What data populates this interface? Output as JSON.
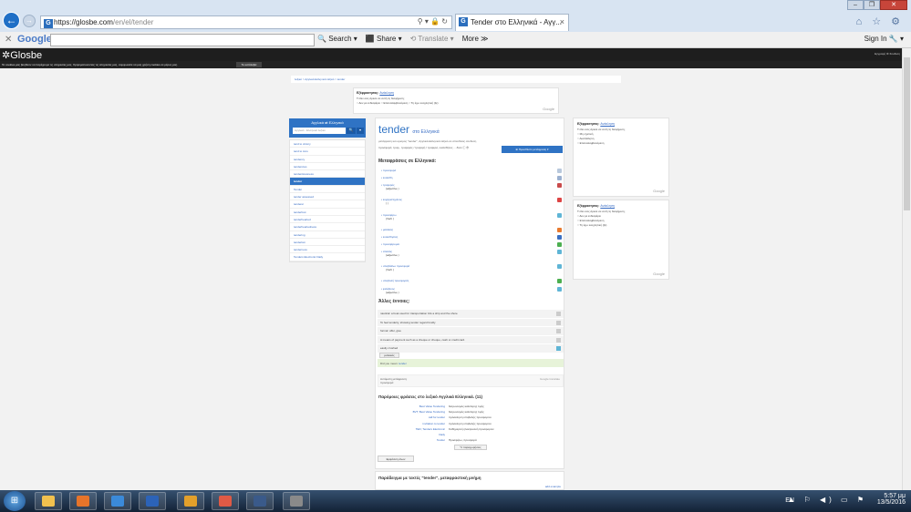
{
  "browser": {
    "url_host": "https://glosbe.com",
    "url_path": "/en/el/tender",
    "tab_title": "Tender στο Ελληνικά - Αγγ...",
    "tab_close": "×",
    "addr_icons": "⚲ ▾ 🔒 ↻",
    "win_min": "–",
    "win_max": "❐",
    "win_close": "✕",
    "right_icons": "⌂ ☆ ⚙"
  },
  "google_toolbar": {
    "close": "✕",
    "logo": "Google",
    "search_label": "Search",
    "share_label": "Share",
    "translate_label": "Translate",
    "more_label": "More ≫",
    "signin_label": "Sign In"
  },
  "glosbe": {
    "logo": "Glosbe",
    "right_text": "Εγγραφή  ⚙  Σύνδεση",
    "cookie_text": "Τα cookies μας βοηθούν να παρέχουμε τις υπηρεσίες μας. Χρησιμοποιώντας τις υπηρεσίες μας, συμφωνείτε να μας χρήση cookies σε μέρος μας.",
    "cookie_btn": "Το κατάλαβα",
    "breadcrumb": "λεξικό  >  Αγγλικά-Ελληνικά λεξικό  >  tender"
  },
  "poll": {
    "label": "Εξέφρασησας:",
    "link": "Ανάκληση",
    "question": "Τι δεν σας άρεσε σε αυτή τη διαφήμιση;",
    "opts": [
      "○ Δεν με ενδιαφέρει",
      "○ Επαναλαμβανόμενη",
      "○ Τη έχω ενοχλητική (ξε)"
    ],
    "footer": "Google"
  },
  "poll_right1": {
    "label": "Εξέφρασησας:",
    "link": "Ανάκληση",
    "question": "Τι δεν σας άρεσε σε αυτή τη διαφήμιση;",
    "opts": [
      "○ Μη σχετική",
      "○ Ακατάλληλη",
      "○ Επαναλαμβανόμενη"
    ],
    "footer": "Google"
  },
  "poll_right2": {
    "label": "Εξέφρασησας:",
    "link": "Ανάκληση",
    "question": "Τι δεν σας άρεσε σε αυτή τη διαφήμιση;",
    "opts": [
      "○ Δεν με ενδιαφέρει",
      "○ Επαναλαμβανόμενη",
      "○ Τη έχω ενοχλητική (ξε)"
    ],
    "footer": "Google"
  },
  "sidebar": {
    "title": "Αγγλικά  ⇄  Ελληνικά",
    "placeholder": "Αγγλικά - Ελληνικά λεξικό",
    "search_icon": "🔍",
    "items": [
      "tend to victory",
      "tend to zero",
      "tendency",
      "tendencies",
      "tendentiousness",
      "tender",
      "Tender",
      "tender assessed",
      "tenderer",
      "tenderfoot",
      "tenderhearted",
      "tenderheartedness",
      "tendering",
      "tenderism",
      "tenderness",
      "Tenders Electronic Daily"
    ],
    "active_index": 5
  },
  "main": {
    "title": "tender",
    "title_small": "στο Ελληνικά",
    "subline": "μετάφραση και ορισμός \"tender\", Αγγλικά-Ελληνικά λεξικό σε απευθείας σύνδεση",
    "subline2": "προσφορά, τρυφ., τρυφερός / τρυφερή / τρυφερό, ευαίσθητος ... δίνει  ⓘ  ⊕",
    "add_translation": "⊕  Προσθέστε μετάφραση  ▾",
    "translations_heading": "Μεταφράσεις σε Ελληνικά:",
    "translations": [
      {
        "word": "προσφορά",
        "pos": ""
      },
      {
        "word": "ευαίσθη",
        "pos": ""
      },
      {
        "word": "τρυφερός",
        "pos": "(adjective   )"
      },
      {
        "word": "ευχαριστημένος",
        "pos": "(   )"
      },
      {
        "word": "προσφέρω",
        "pos": "(Verb   )"
      },
      {
        "word": "μαλακός",
        "pos": ""
      },
      {
        "word": "ευαισθησίας",
        "pos": ""
      },
      {
        "word": "προσφέρομαι",
        "pos": ""
      },
      {
        "word": "απαλός",
        "pos": "(adjective   )"
      },
      {
        "word": "υποβάλλω προσφορά",
        "pos": "(Verb   )"
      },
      {
        "word": "υποβολή προσφοράς",
        "pos": ""
      },
      {
        "word": "φιλόξενος",
        "pos": "(adjective   )"
      }
    ],
    "icon_colors": [
      "#b8c8dc",
      "#9bb0d0",
      "#c94b4b",
      "#d44",
      "#5fb5d6",
      "#e87a2e",
      "#3a6fc2",
      "#4caf50",
      "#5fb5d6",
      "#5fb5d6",
      "#4caf50",
      "#5fb5d6"
    ],
    "other_heading": "Άλλες έννοιες:",
    "meanings": [
      "nautical: a boat used for transportation b/w a ship and the shore",
      "To feel tenderly, showing tender regard fondly",
      "formal: offer, give",
      "A means of payment such as a cheque or cheque, cash or credit card.",
      "easily crushed"
    ],
    "meaning_tag": "μαλακός",
    "did_you_mean_label": "Did you mean:",
    "did_you_mean_word": "tender",
    "gtrans_label": "Αυτόματη μετάφραση:",
    "gtrans_value": "προσφορά",
    "gtrans_brand": "Google translate",
    "phrases_heading": "Παρόμοιες φράσεις στο λεξικό Αγγλικά Ελληνικά. (11)",
    "phrases": [
      {
        "en": "Best Value Tendering",
        "el": "διαγωνισμός καλύτερης τιμής"
      },
      {
        "en": "BVT; Best Value Tendering",
        "el": "διαγωνισμός καλύτερης τιμής"
      },
      {
        "en": "call for tender",
        "el": "πρόσκληση υποβολής προσφορών"
      },
      {
        "en": "invitation to tender",
        "el": "πρόσκληση υποβολής προσφορών"
      },
      {
        "en": "TED; Tenders Electronic",
        "el": "Καθημερινή ηλεκτρονική προσφορών"
      },
      {
        "en": "Daily",
        "el": ""
      },
      {
        "en": "Tender",
        "el": "Προσφέρω, προσφορά"
      }
    ],
    "tag_box": "½  παραχωρήσεις",
    "show_all": "Εμφάνιση όλων",
    "examples_heading": "Παράδειγμα με τεκτές \"tender\", μεταφραστική μνήμη",
    "examples_link": "add example"
  },
  "taskbar": {
    "start": "⊞",
    "lang": "EN",
    "tray_icons": "▲ ⚐ ◀) ▭ ⚑",
    "time": "5:57 μμ",
    "date": "13/5/2016",
    "apps": [
      "#f2c14e",
      "#e6742a",
      "#3b8ad9",
      "#2c63b8",
      "#e3a02b",
      "#e05a45",
      "#3a5a8a",
      "#8a8a8a"
    ]
  }
}
